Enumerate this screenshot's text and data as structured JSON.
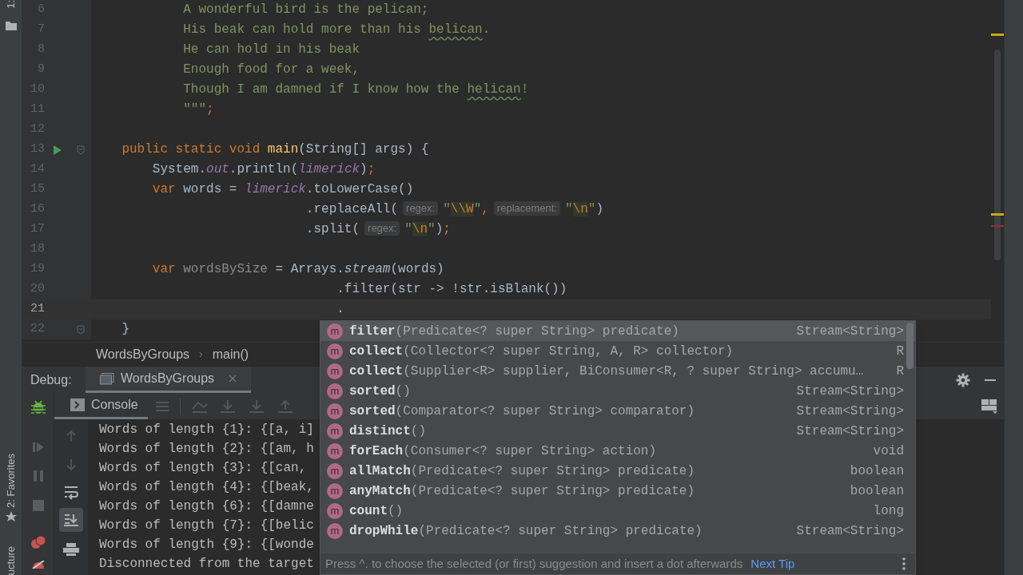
{
  "tool_stripe": {
    "top_label": "1:",
    "favorites_label": "2: Favorites",
    "bottom_label": "ucture"
  },
  "editor": {
    "lines": [
      {
        "number": "6",
        "current": false,
        "run_button": false,
        "fold_marker": false,
        "tokens": [
          {
            "kind": "string",
            "text": "            A wonderful bird is the pelican;"
          }
        ]
      },
      {
        "number": "7",
        "current": false,
        "run_button": false,
        "fold_marker": false,
        "tokens": [
          {
            "kind": "string",
            "text": "            His beak can hold more than his "
          },
          {
            "kind": "typo",
            "text": "belican"
          },
          {
            "kind": "string",
            "text": "."
          }
        ]
      },
      {
        "number": "8",
        "current": false,
        "run_button": false,
        "fold_marker": false,
        "tokens": [
          {
            "kind": "string",
            "text": "            He can hold in his beak"
          }
        ]
      },
      {
        "number": "9",
        "current": false,
        "run_button": false,
        "fold_marker": false,
        "tokens": [
          {
            "kind": "string",
            "text": "            Enough food for a week,"
          }
        ]
      },
      {
        "number": "10",
        "current": false,
        "run_button": false,
        "fold_marker": false,
        "tokens": [
          {
            "kind": "string",
            "text": "            Though I am damned if I know how the "
          },
          {
            "kind": "typo",
            "text": "helican"
          },
          {
            "kind": "string",
            "text": "!"
          }
        ]
      },
      {
        "number": "11",
        "current": false,
        "run_button": false,
        "fold_marker": false,
        "tokens": [
          {
            "kind": "string",
            "text": "            \"\"\""
          },
          {
            "kind": "keyword",
            "text": ";"
          }
        ]
      },
      {
        "number": "12",
        "current": false,
        "run_button": false,
        "fold_marker": false
      },
      {
        "number": "13",
        "current": false,
        "run_button": true,
        "fold_marker": true,
        "tokens": [
          {
            "kind": "keyword",
            "text": "    public static void "
          },
          {
            "kind": "method",
            "text": "main"
          },
          {
            "kind": "plain",
            "text": "(String[] args) {"
          }
        ]
      },
      {
        "number": "14",
        "current": false,
        "run_button": false,
        "fold_marker": false,
        "tokens": [
          {
            "kind": "plain",
            "text": "        System."
          },
          {
            "kind": "static",
            "text": "out"
          },
          {
            "kind": "plain",
            "text": ".println("
          },
          {
            "kind": "static",
            "text": "limerick"
          },
          {
            "kind": "plain",
            "text": ")"
          },
          {
            "kind": "keyword",
            "text": ";"
          }
        ]
      },
      {
        "number": "15",
        "current": false,
        "run_button": false,
        "fold_marker": false,
        "tokens": [
          {
            "kind": "keyword",
            "text": "        var "
          },
          {
            "kind": "plain",
            "text": "words = "
          },
          {
            "kind": "static",
            "text": "limerick"
          },
          {
            "kind": "plain",
            "text": ".toLowerCase()"
          }
        ]
      },
      {
        "number": "16",
        "current": false,
        "run_button": false,
        "fold_marker": false,
        "tokens": [
          {
            "kind": "plain",
            "text": "                            .replaceAll("
          },
          {
            "kind": "hint",
            "text": "regex:"
          },
          {
            "kind": "string",
            "text": "\""
          },
          {
            "kind": "escape",
            "text": "\\\\W"
          },
          {
            "kind": "string",
            "text": "\""
          },
          {
            "kind": "keyword",
            "text": ","
          },
          {
            "kind": "hint",
            "text": "replacement:"
          },
          {
            "kind": "string",
            "text": "\""
          },
          {
            "kind": "escape",
            "text": "\\n"
          },
          {
            "kind": "string",
            "text": "\""
          },
          {
            "kind": "plain",
            "text": ")"
          }
        ]
      },
      {
        "number": "17",
        "current": false,
        "run_button": false,
        "fold_marker": false,
        "tokens": [
          {
            "kind": "plain",
            "text": "                            .split("
          },
          {
            "kind": "hint",
            "text": "regex:"
          },
          {
            "kind": "string",
            "text": "\""
          },
          {
            "kind": "escape",
            "text": "\\n"
          },
          {
            "kind": "string",
            "text": "\""
          },
          {
            "kind": "plain",
            "text": ")"
          },
          {
            "kind": "keyword",
            "text": ";"
          }
        ]
      },
      {
        "number": "18",
        "current": false,
        "run_button": false,
        "fold_marker": false
      },
      {
        "number": "19",
        "current": false,
        "run_button": false,
        "fold_marker": false,
        "tokens": [
          {
            "kind": "keyword",
            "text": "        var "
          },
          {
            "kind": "unused",
            "text": "wordsBySize"
          },
          {
            "kind": "plain",
            "text": " = Arrays."
          },
          {
            "kind": "italic",
            "text": "stream"
          },
          {
            "kind": "plain",
            "text": "(words)"
          }
        ]
      },
      {
        "number": "20",
        "current": false,
        "run_button": false,
        "fold_marker": false,
        "tokens": [
          {
            "kind": "plain",
            "text": "                                .filter(str -> !str.isBlank())"
          }
        ]
      },
      {
        "number": "21",
        "current": true,
        "run_button": false,
        "fold_marker": false,
        "tokens": [
          {
            "kind": "plain",
            "text": "                                ."
          }
        ]
      },
      {
        "number": "22",
        "current": false,
        "run_button": false,
        "fold_marker": true,
        "tokens": [
          {
            "kind": "plain",
            "text": "    }"
          }
        ]
      }
    ]
  },
  "breadcrumb": {
    "items": [
      "WordsByGroups",
      "main()"
    ],
    "separator": "›"
  },
  "debug": {
    "label": "Debug:",
    "tabs": [
      {
        "label": "WordsByGroups",
        "selected": true
      }
    ],
    "console_tab": {
      "label": "Console",
      "selected": true
    },
    "output": [
      "Words of length {1}: {[a, i]",
      "Words of length {2}: {[am, h",
      "Words of length {3}: {[can,",
      "Words of length {4}: {[beak,",
      "Words of length {6}: {[damne",
      "Words of length {7}: {[belic",
      "Words of length {9}: {[wonde",
      "Disconnected from the target"
    ]
  },
  "completion": {
    "items": [
      {
        "icon": "m",
        "name": "filter",
        "params": "(Predicate<? super String> predicate)",
        "type": "Stream<String>",
        "selected": true
      },
      {
        "icon": "m",
        "name": "collect",
        "params": "(Collector<? super String, A, R> collector)",
        "type": "R",
        "selected": false
      },
      {
        "icon": "m",
        "name": "collect",
        "params": "(Supplier<R> supplier, BiConsumer<R, ? super String> accumu…",
        "type": "R",
        "selected": false
      },
      {
        "icon": "m",
        "name": "sorted",
        "params": "()",
        "type": "Stream<String>",
        "selected": false
      },
      {
        "icon": "m",
        "name": "sorted",
        "params": "(Comparator<? super String> comparator)",
        "type": "Stream<String>",
        "selected": false
      },
      {
        "icon": "m",
        "name": "distinct",
        "params": "()",
        "type": "Stream<String>",
        "selected": false
      },
      {
        "icon": "m",
        "name": "forEach",
        "params": "(Consumer<? super String> action)",
        "type": "void",
        "selected": false
      },
      {
        "icon": "m",
        "name": "allMatch",
        "params": "(Predicate<? super String> predicate)",
        "type": "boolean",
        "selected": false
      },
      {
        "icon": "m",
        "name": "anyMatch",
        "params": "(Predicate<? super String> predicate)",
        "type": "boolean",
        "selected": false
      },
      {
        "icon": "m",
        "name": "count",
        "params": "()",
        "type": "long",
        "selected": false
      },
      {
        "icon": "m",
        "name": "dropWhile",
        "params": "(Predicate<? super String> predicate)",
        "type": "Stream<String>",
        "selected": false
      }
    ],
    "hint": "Press ^. to choose the selected (or first) suggestion and insert a dot afterwards",
    "next_tip": "Next Tip"
  }
}
